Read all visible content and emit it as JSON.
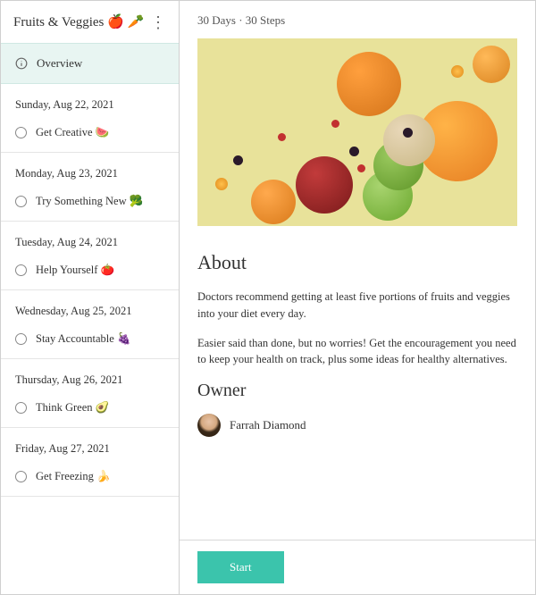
{
  "sidebar": {
    "title": "Fruits & Veggies 🍎 🥕",
    "overview_label": "Overview",
    "days": [
      {
        "date": "Sunday, Aug 22, 2021",
        "step": "Get Creative 🍉"
      },
      {
        "date": "Monday, Aug 23, 2021",
        "step": "Try Something New 🥦"
      },
      {
        "date": "Tuesday, Aug 24, 2021",
        "step": "Help Yourself 🍅"
      },
      {
        "date": "Wednesday, Aug 25, 2021",
        "step": "Stay Accountable 🍇"
      },
      {
        "date": "Thursday, Aug 26, 2021",
        "step": "Think Green 🥑"
      },
      {
        "date": "Friday, Aug 27, 2021",
        "step": "Get Freezing 🍌"
      }
    ]
  },
  "main": {
    "meta": "30 Days  ·  30 Steps",
    "about_heading": "About",
    "about_p1": "Doctors recommend getting at least five portions of fruits and veggies into your diet every day.",
    "about_p2": "Easier said than done, but no worries! Get the encouragement you need to keep your health on track, plus some ideas for healthy alternatives.",
    "owner_heading": "Owner",
    "owner_name": "Farrah Diamond",
    "start_label": "Start"
  },
  "colors": {
    "accent": "#3bc4ac",
    "selected_bg": "#e8f5f2"
  }
}
